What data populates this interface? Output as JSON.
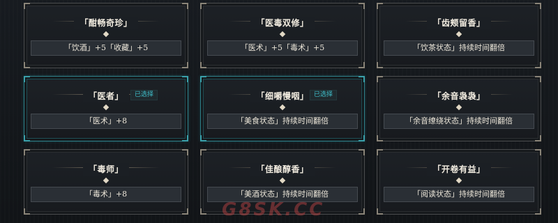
{
  "cards": [
    {
      "title": "「酣畅奇珍」",
      "effect": "「饮酒」+5「收藏」+5",
      "selected": false,
      "badge": ""
    },
    {
      "title": "「医毒双修」",
      "effect": "「医术」+5「毒术」+5",
      "selected": false,
      "badge": ""
    },
    {
      "title": "「齿颊留香」",
      "effect": "「饮茶状态」持续时间翻倍",
      "selected": false,
      "badge": ""
    },
    {
      "title": "「医者」",
      "effect": "「医术」+8",
      "selected": true,
      "badge": "已选择"
    },
    {
      "title": "「细嚼慢咽」",
      "effect": "「美食状态」持续时间翻倍",
      "selected": true,
      "badge": "已选择"
    },
    {
      "title": "「余音袅袅」",
      "effect": "「余音缭绕状态」持续时间翻倍",
      "selected": false,
      "badge": ""
    },
    {
      "title": "「毒师」",
      "effect": "「毒术」+8",
      "selected": false,
      "badge": ""
    },
    {
      "title": "「佳酿醇香」",
      "effect": "「美酒状态」持续时间翻倍",
      "selected": false,
      "badge": ""
    },
    {
      "title": "「开卷有益」",
      "effect": "「阅读状态」持续时间翻倍",
      "selected": false,
      "badge": ""
    }
  ],
  "watermark": "G8SK.CC"
}
